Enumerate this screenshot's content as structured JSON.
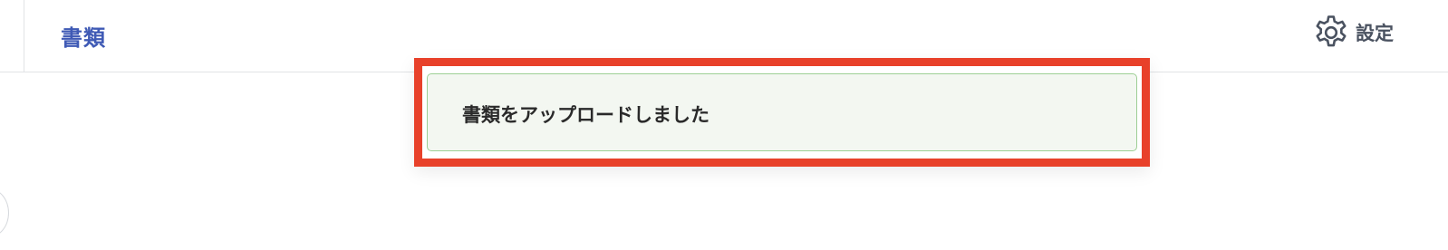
{
  "header": {
    "title": "書類",
    "settings_label": "設定",
    "settings_icon": "gear-icon"
  },
  "notification": {
    "message": "書類をアップロードしました"
  },
  "colors": {
    "title": "#3f5ab5",
    "highlight_border": "#e8412a",
    "toast_background": "#f3f7f1",
    "toast_border": "#9dcf95"
  }
}
